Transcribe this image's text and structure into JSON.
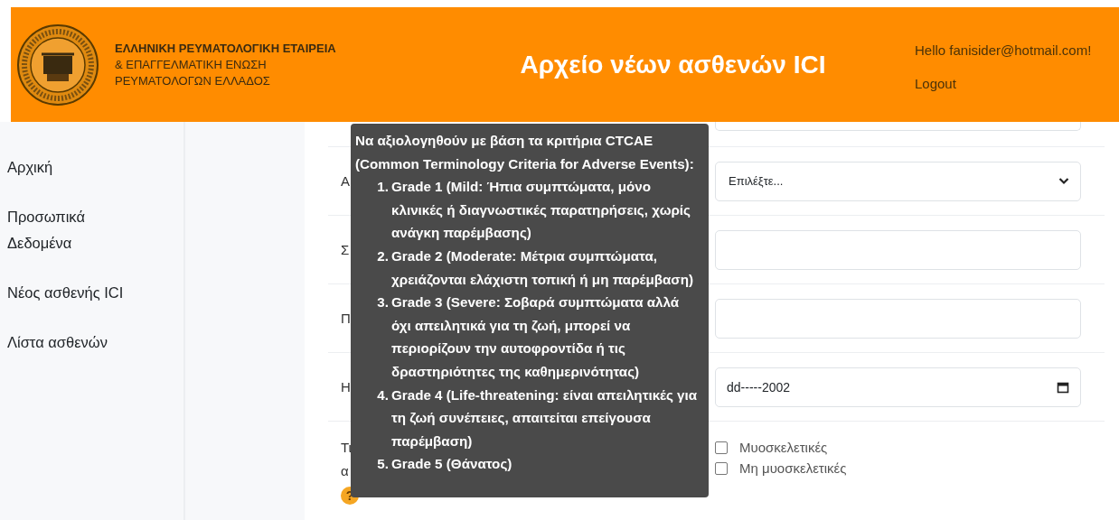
{
  "header": {
    "org_lines": [
      "ΕΛΛΗΝΙΚΗ ΡΕΥΜΑΤΟΛΟΓΙΚΗ ΕΤΑΙΡΕΙΑ",
      "& ΕΠΑΓΓΕΛΜΑΤΙΚΗ ΕΝΩΣΗ",
      "ΡΕΥΜΑΤΟΛΟΓΩΝ ΕΛΛΑΔΟΣ"
    ],
    "title": "Αρχείο νέων ασθενών ICI",
    "greeting": "Hello fanisider@hotmail.com!",
    "logout": "Logout"
  },
  "sidebar": {
    "items": [
      "Αρχική",
      "Προσωπικά Δεδομένα",
      "Νέος ασθενής ICI",
      "Λίστα ασθενών"
    ]
  },
  "form": {
    "rows": [
      {
        "kind": "cut"
      },
      {
        "kind": "select",
        "label_lines": [
          "Α"
        ],
        "value": "Επιλέξτε..."
      },
      {
        "kind": "text",
        "label_lines": [
          "Σ"
        ]
      },
      {
        "kind": "text",
        "label_lines": [
          "Π"
        ]
      },
      {
        "kind": "date",
        "label_lines": [
          "Η"
        ],
        "value": "dd-----2002"
      },
      {
        "kind": "checkboxes",
        "label_lines": [
          "Τι",
          "α"
        ],
        "help": "?",
        "options": [
          {
            "label": "Μυοσκελετικές",
            "checked": false
          },
          {
            "label": "Μη μυοσκελετικές",
            "checked": false
          }
        ]
      }
    ]
  },
  "tooltip": {
    "intro": "Να αξιολογηθούν με βάση τα κριτήρια CTCAE (Common Terminology Criteria for Adverse Events):",
    "items": [
      {
        "number": "1.",
        "text": "Grade 1 (Mild: Ήπια συμπτώματα, μόνο κλινικές ή διαγνωστικές παρατηρήσεις, χωρίς ανάγκη παρέμβασης)"
      },
      {
        "number": "2.",
        "text": "Grade 2 (Moderate: Μέτρια συμπτώματα, χρειάζονται ελάχιστη τοπική ή μη παρέμβαση)"
      },
      {
        "number": "3.",
        "text": "Grade 3 (Severe: Σοβαρά συμπτώματα αλλά όχι απειλητικά για τη ζωή, μπορεί να περιορίζουν την αυτοφροντίδα ή τις δραστηριότητες της καθημερινότητας)"
      },
      {
        "number": "4.",
        "text": "Grade 4 (Life-threatening: είναι απειλητικές για τη ζωή συνέπειες, απαιτείται επείγουσα παρέμβαση)"
      },
      {
        "number": "5.",
        "text": "Grade 5 (Θάνατος)"
      }
    ]
  }
}
